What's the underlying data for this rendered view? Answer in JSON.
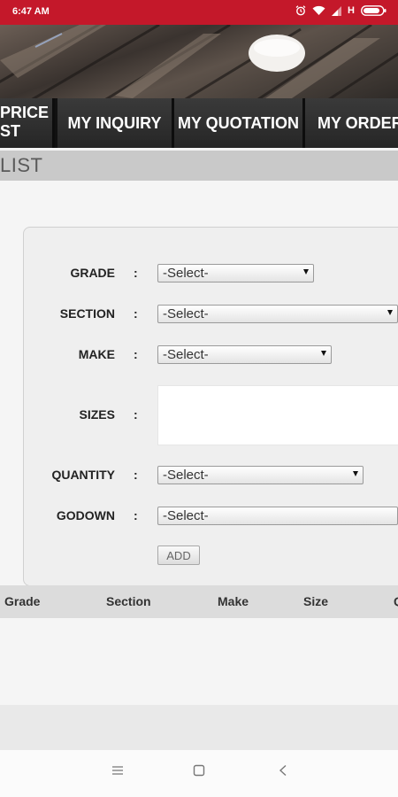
{
  "status_bar": {
    "time": "6:47 AM",
    "network_type": "H"
  },
  "nav": {
    "tabs": [
      {
        "label_line1": "PRICE",
        "label_line2": "ST"
      },
      {
        "label": "MY INQUIRY"
      },
      {
        "label": "MY QUOTATION"
      },
      {
        "label": "MY ORDER"
      }
    ]
  },
  "section": {
    "title": "LIST"
  },
  "form": {
    "fields": [
      {
        "label": "GRADE",
        "colon": ":",
        "value": "-Select-"
      },
      {
        "label": "SECTION",
        "colon": ":",
        "value": "-Select-"
      },
      {
        "label": "MAKE",
        "colon": ":",
        "value": "-Select-"
      },
      {
        "label": "SIZES",
        "colon": ":"
      },
      {
        "label": "QUANTITY",
        "colon": ":",
        "value": "-Select-"
      },
      {
        "label": "GODOWN",
        "colon": ":",
        "value": "-Select-"
      }
    ],
    "add_label": "ADD"
  },
  "table": {
    "columns": [
      "Grade",
      "Section",
      "Make",
      "Size",
      "Q"
    ]
  },
  "colors": {
    "status_bar": "#c4182a",
    "nav_bg": "#262626",
    "section_header": "#c9c9c9"
  },
  "icons": [
    "alarm-icon",
    "wifi-icon",
    "signal-icon",
    "battery-icon",
    "menu-icon",
    "home-icon",
    "back-icon"
  ]
}
